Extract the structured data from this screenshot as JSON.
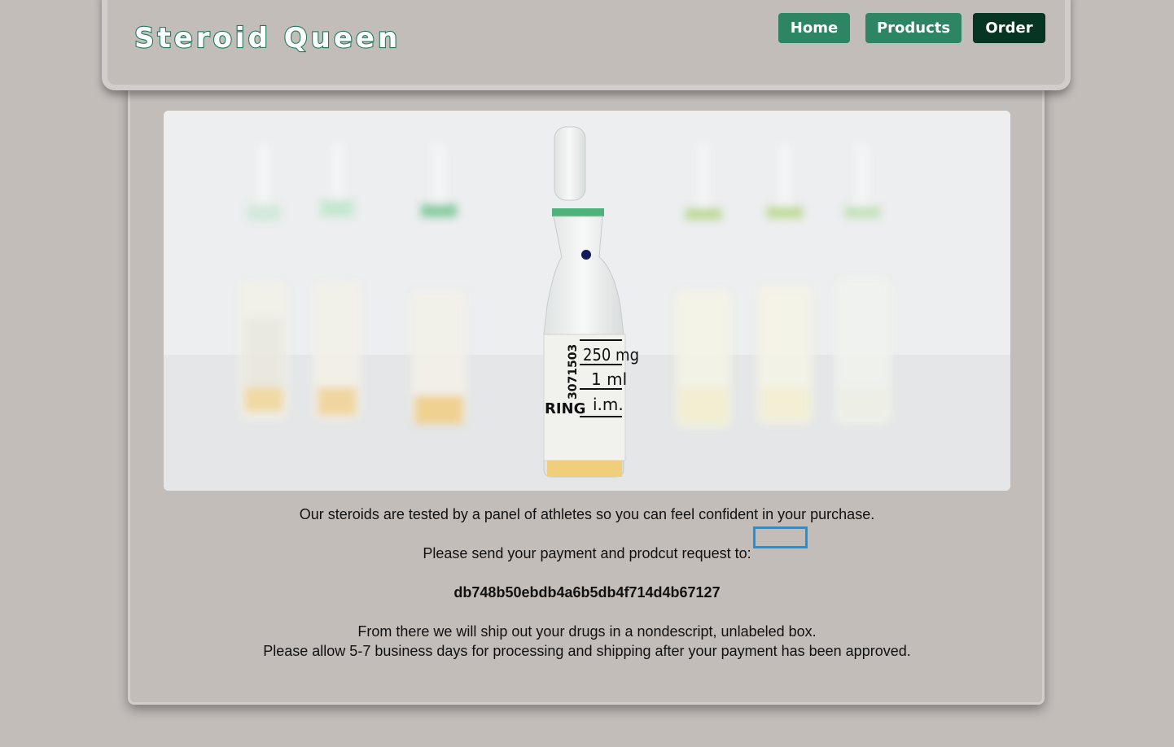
{
  "header": {
    "logo_text": "Steroid Queen",
    "nav": [
      {
        "label": "Home"
      },
      {
        "label": "Products"
      },
      {
        "label": "Order",
        "active": true
      }
    ]
  },
  "hero": {
    "label": {
      "dose": "250 mg",
      "volume": "1 ml",
      "route": "i.m.",
      "batch": "3071503",
      "brand_fragment": "RING"
    }
  },
  "content": {
    "intro": "Our steroids are tested by a panel of athletes so you can feel confident in your purchase.",
    "payment_instruction": "Please send your payment and prodcut request to:",
    "address": "db748b50ebdb4a6b5db4f714d4b67127",
    "shipping_line1": "From there we will ship out your drugs in a nondescript, unlabeled box.",
    "shipping_line2": "Please allow 5-7 business days for processing and shipping after your payment has been approved."
  },
  "colors": {
    "background": "#c3bdba",
    "nav_button": "#2e8564",
    "nav_button_active": "#073524",
    "logo_stroke": "#1f7a5a",
    "highlight": "#1a93e0"
  }
}
